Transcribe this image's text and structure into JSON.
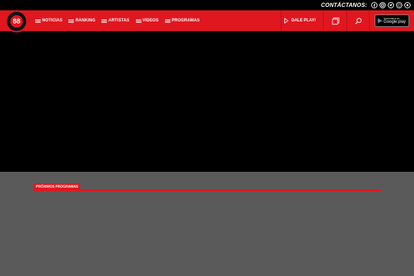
{
  "topbar": {
    "contact_label": "CONTÁCTANOS:",
    "social": [
      "facebook-icon",
      "instagram-icon",
      "twitter-icon",
      "whatsapp-icon",
      "android-icon"
    ]
  },
  "logo": {
    "text": "88"
  },
  "nav": {
    "items": [
      {
        "label": "NOTICIAS"
      },
      {
        "label": "RANKING"
      },
      {
        "label": "ARTISTAS"
      },
      {
        "label": "VIDEOS"
      },
      {
        "label": "PROGRAMAS"
      }
    ],
    "play_label": "DALE PLAY!"
  },
  "store": {
    "small": "DISPONIBLE EN",
    "big": "Google play"
  },
  "section": {
    "title": "PRÓXIMOS PROGRAMAS"
  },
  "colors": {
    "brand_red": "#e0171f",
    "page_bg": "#5a5a5a",
    "player_bg": "#000000"
  }
}
